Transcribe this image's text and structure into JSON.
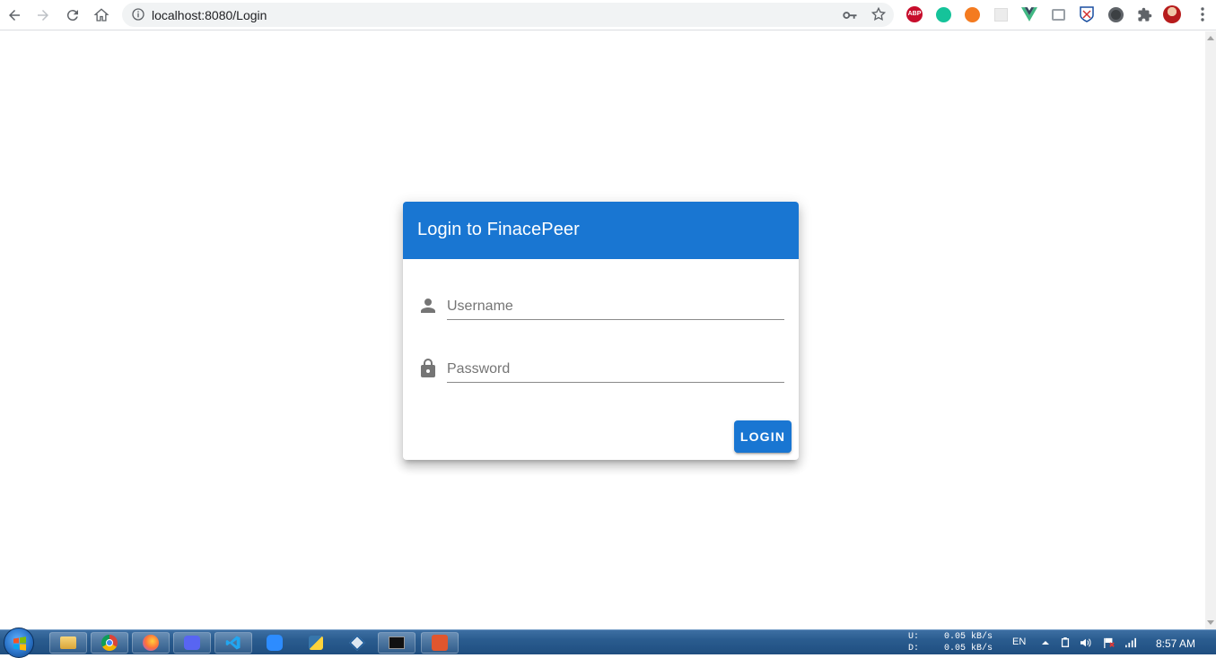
{
  "browser": {
    "url": "localhost:8080/Login",
    "extensions": [
      "abp-icon",
      "grammarly-icon",
      "orange-extension-icon",
      "grid-extension-icon",
      "vue-devtools-icon",
      "reader-extension-icon",
      "shield-extension-icon",
      "vpn-extension-icon",
      "puzzle-extensions-icon"
    ],
    "abp_label": "ABP"
  },
  "login": {
    "title": "Login to FinacePeer",
    "username_placeholder": "Username",
    "password_placeholder": "Password",
    "button_label": "LOGIN",
    "accent": "#1976d2"
  },
  "taskbar": {
    "apps": [
      "explorer-icon",
      "chrome-icon",
      "firefox-icon",
      "discord-icon",
      "vscode-icon",
      "zoom-icon",
      "python-icon",
      "virtualbox-icon",
      "terminal-icon",
      "recorder-icon"
    ],
    "network_up_label": "U:",
    "network_up": "0.05 kB/s",
    "network_down_label": "D:",
    "network_down": "0.05 kB/s",
    "language": "EN",
    "time": "8:57 AM"
  }
}
